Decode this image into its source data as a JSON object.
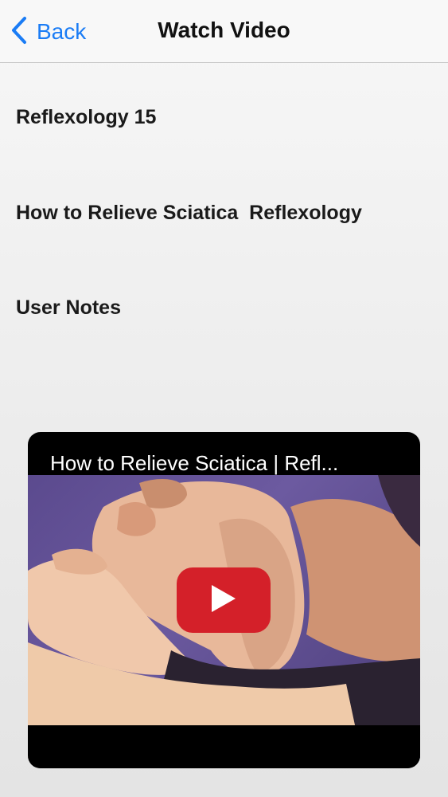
{
  "navbar": {
    "back_label": "Back",
    "title": "Watch Video"
  },
  "info": {
    "line1": "Reflexology 15",
    "line2": "How to Relieve Sciatica  Reflexology",
    "line3": "User Notes"
  },
  "video": {
    "title": "How to Relieve Sciatica | Refl...",
    "play_color": "#d42029"
  },
  "colors": {
    "accent": "#1a7cf5"
  }
}
